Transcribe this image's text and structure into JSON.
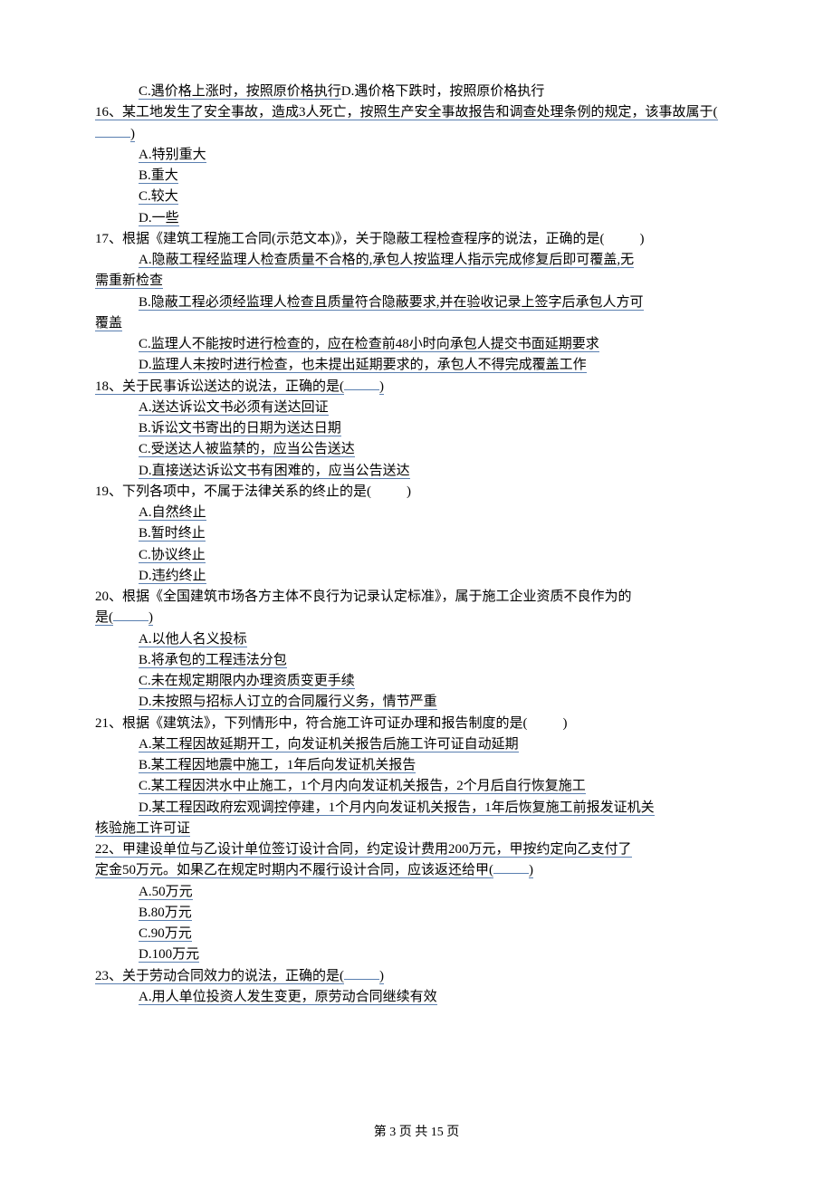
{
  "q15_tail": {
    "optC": "C.遇价格上涨时，按照原价格执行",
    "optD": "D.遇价格下跌时，按照原价格执行"
  },
  "q16": {
    "stem": "16、某工地发生了安全事故，造成3人死亡，按照生产安全事故报告和调查处理条例的规定，该事故属于(",
    "stem_end": ")",
    "A": "A.特别重大",
    "B": "B.重大",
    "C": "C.较大",
    "D": "D.一些"
  },
  "q17": {
    "stem1_a": "17、根据《建筑工程施工合同(示范文本)》，关于隐蔽工程检查程序的说法，正确的是(",
    "stem1_b": ")",
    "A1": "A.隐蔽工程经监理人检查质量不合格的,承包人按监理人指示完成修复后即可覆盖,无",
    "A2": "需重新检查",
    "B1": "B.隐蔽工程必须经监理人检查且质量符合隐蔽要求,并在验收记录上签字后承包人方可",
    "B2": "覆盖",
    "C": "C.监理人不能按时进行检查的，应在检查前48小时向承包人提交书面延期要求",
    "D": "D.监理人未按时进行检查，也未提出延期要求的，承包人不得完成覆盖工作"
  },
  "q18": {
    "stem_a": "18、关于民事诉讼送达的说法，正确的是(",
    "stem_b": ")",
    "A": "A.送达诉讼文书必须有送达回证",
    "B": "B.诉讼文书寄出的日期为送达日期",
    "C": "C.受送达人被监禁的，应当公告送达",
    "D": "D.直接送达诉讼文书有困难的，应当公告送达"
  },
  "q19": {
    "stem_a": "19、下列各项中，不属于法律关系的终止的是(",
    "stem_b": ")",
    "A": "A.自然终止",
    "B": "B.暂时终止",
    "C": "C.协议终止",
    "D": "D.违约终止"
  },
  "q20": {
    "stem1": "20、根据《全国建筑市场各方主体不良行为记录认定标准》，属于施工企业资质不良作为的",
    "stem2_a": "是(",
    "stem2_b": ")",
    "A": "A.以他人名义投标",
    "B": "B.将承包的工程违法分包",
    "C": "C.未在规定期限内办理资质变更手续",
    "D": "D.未按照与招标人订立的合同履行义务，情节严重"
  },
  "q21": {
    "stem_a": "21、根据《建筑法》，下列情形中，符合施工许可证办理和报告制度的是(",
    "stem_b": ")",
    "A": "A.某工程因故延期开工，向发证机关报告后施工许可证自动延期",
    "B": "B.某工程因地震中施工，1年后向发证机关报告",
    "C": "C.某工程因洪水中止施工，1个月内向发证机关报告，2个月后自行恢复施工",
    "D1": "D.某工程因政府宏观调控停建，1个月内向发证机关报告，1年后恢复施工前报发证机关",
    "D2": "核验施工许可证"
  },
  "q22": {
    "stem1": "22、甲建设单位与乙设计单位签订设计合同，约定设计费用200万元，甲按约定向乙支付了",
    "stem2_a": "定金50万元。如果乙在规定时期内不履行设计合同，应该返还给甲(",
    "stem2_b": ")",
    "A": "A.50万元",
    "B": "B.80万元",
    "C": "C.90万元",
    "D": "D.100万元"
  },
  "q23": {
    "stem_a": "23、关于劳动合同效力的说法，正确的是(",
    "stem_b": ")",
    "A": "A.用人单位投资人发生变更，原劳动合同继续有效"
  },
  "footer": "第 3 页 共 15 页"
}
